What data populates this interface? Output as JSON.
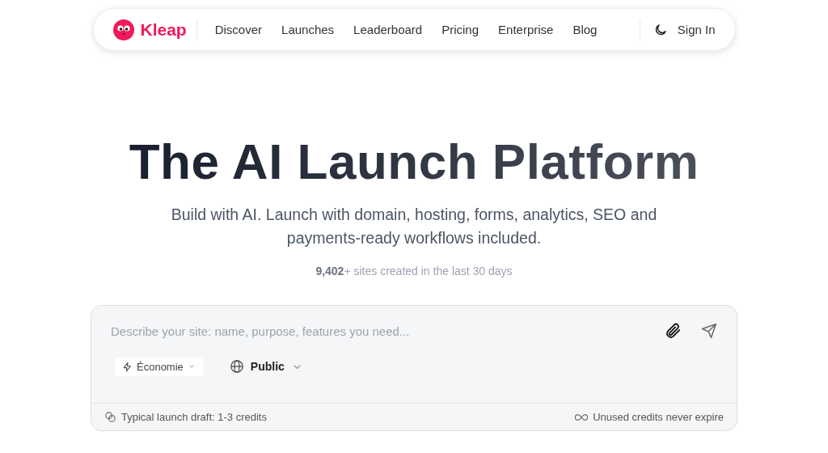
{
  "nav": {
    "brand": "Kleap",
    "links": [
      "Discover",
      "Launches",
      "Leaderboard",
      "Pricing",
      "Enterprise",
      "Blog"
    ],
    "sign_in": "Sign In"
  },
  "hero": {
    "title": "The AI Launch Platform",
    "subtitle": "Build with AI. Launch with domain, hosting, forms, analytics, SEO and payments-ready workflows included.",
    "stats": "**9,402**+ sites created in the last 30 days"
  },
  "prompt": {
    "placeholder": "Describe your site: name, purpose, features you need...",
    "mode": "Économie",
    "visibility": "Public",
    "footer_left": "Typical launch draft: 1-3 credits",
    "footer_right": "Unused credits never expire"
  }
}
